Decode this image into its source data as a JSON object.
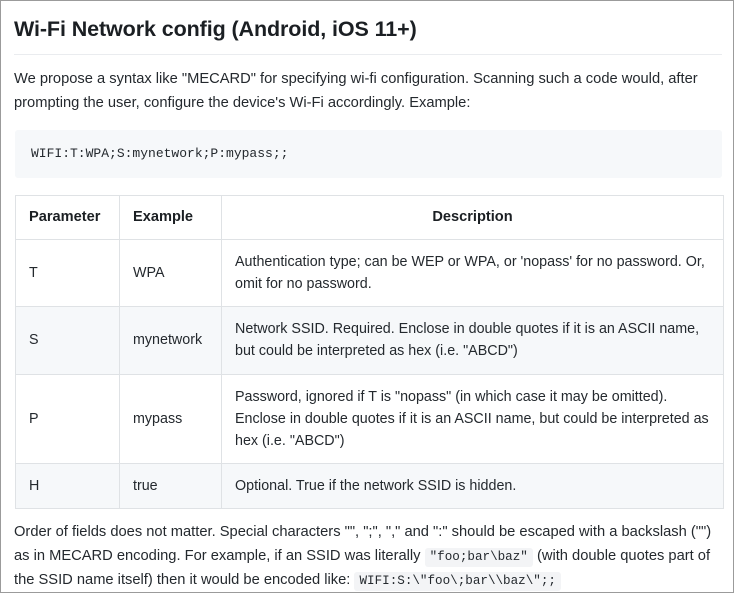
{
  "document": {
    "title": "Wi-Fi Network config (Android, iOS 11+)",
    "intro_paragraph": "We propose a syntax like \"MECARD\" for specifying wi-fi configuration. Scanning such a code would, after prompting the user, configure the device's Wi-Fi accordingly. Example:",
    "example_code": "WIFI:T:WPA;S:mynetwork;P:mypass;;",
    "table": {
      "headers": {
        "parameter": "Parameter",
        "example": "Example",
        "description": "Description"
      },
      "rows": [
        {
          "parameter": "T",
          "example": "WPA",
          "description": "Authentication type; can be WEP or WPA, or 'nopass' for no password. Or, omit for no password."
        },
        {
          "parameter": "S",
          "example": "mynetwork",
          "description": "Network SSID. Required. Enclose in double quotes if it is an ASCII name, but could be interpreted as hex (i.e. \"ABCD\")"
        },
        {
          "parameter": "P",
          "example": "mypass",
          "description": "Password, ignored if T is \"nopass\" (in which case it may be omitted). Enclose in double quotes if it is an ASCII name, but could be interpreted as hex (i.e. \"ABCD\")"
        },
        {
          "parameter": "H",
          "example": "true",
          "description": "Optional. True if the network SSID is hidden."
        }
      ]
    },
    "closing_paragraph_part1": "Order of fields does not matter. Special characters \"\", \";\", \",\" and \":\" should be escaped with a backslash (\"\") as in MECARD encoding. For example, if an SSID was literally",
    "closing_inline_code": "\"foo;bar\\baz\"",
    "closing_paragraph_part2": "(with double quotes part of the SSID name itself) then it would be encoded like:",
    "closing_code": "WIFI:S:\\\"foo\\;bar\\\\baz\\\";;"
  },
  "colors": {
    "text": "#24292e",
    "heading": "#1b1f23",
    "rule": "#eaecef",
    "code_background": "#f6f8fa",
    "table_border": "#dfe2e5",
    "page_border": "#9b9b9b"
  }
}
